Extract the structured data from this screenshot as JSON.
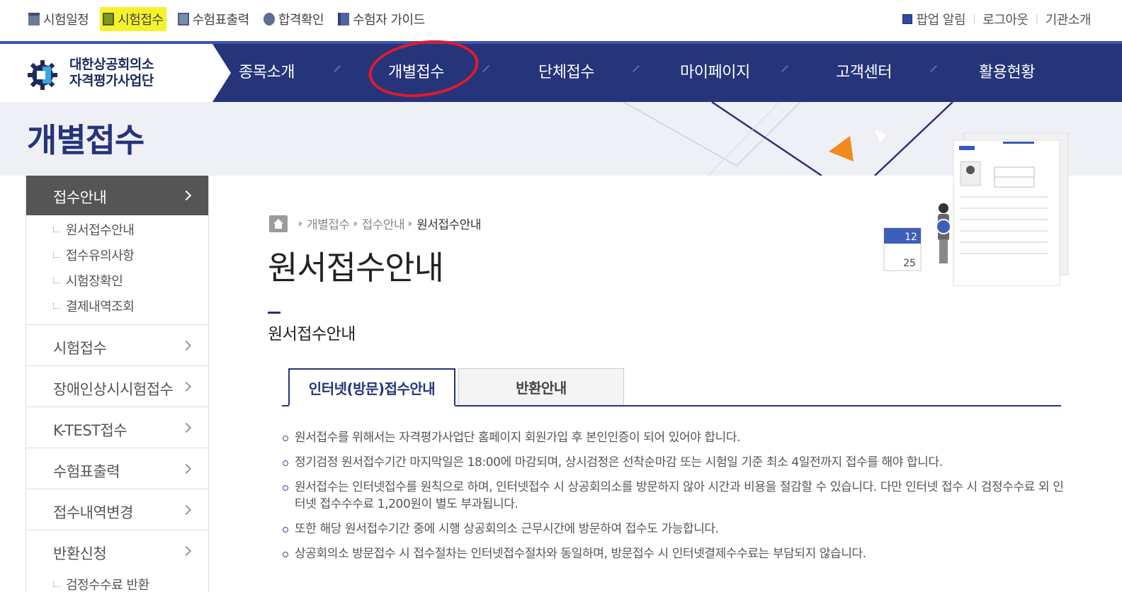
{
  "utility_nav": {
    "left": [
      {
        "label": "시험일정",
        "icon": "calendar-icon"
      },
      {
        "label": "시험접수",
        "icon": "pen-icon",
        "active": true
      },
      {
        "label": "수험표출력",
        "icon": "print-icon"
      },
      {
        "label": "합격확인",
        "icon": "badge-icon"
      },
      {
        "label": "수험자 가이드",
        "icon": "book-icon"
      }
    ],
    "right": [
      {
        "label": "팝업 알림",
        "icon": "popup-icon"
      },
      {
        "label": "로그아웃"
      },
      {
        "label": "기관소개"
      }
    ]
  },
  "logo": {
    "line1": "대한상공회의소",
    "line2": "자격평가사업단"
  },
  "main_nav": [
    {
      "label": "종목소개"
    },
    {
      "label": "개별접수",
      "highlighted": true
    },
    {
      "label": "단체접수"
    },
    {
      "label": "마이페이지"
    },
    {
      "label": "고객센터"
    },
    {
      "label": "활용현황"
    }
  ],
  "hero": {
    "title": "개별접수"
  },
  "sidebar": {
    "header": "접수안내",
    "sub_items": [
      {
        "label": "원서접수안내"
      },
      {
        "label": "접수유의사항"
      },
      {
        "label": "시험장확인"
      },
      {
        "label": "결제내역조회"
      }
    ],
    "items": [
      {
        "label": "시험접수"
      },
      {
        "label": "장애인상시시험접수"
      },
      {
        "label": "K-TEST접수"
      },
      {
        "label": "수험표출력"
      },
      {
        "label": "접수내역변경"
      },
      {
        "label": "반환신청"
      }
    ],
    "trailing_sub": "검정수수료 반환"
  },
  "breadcrumb": {
    "items": [
      "개별접수",
      "접수안내"
    ],
    "current": "원서접수안내"
  },
  "page": {
    "title": "원서접수안내",
    "section_title": "원서접수안내"
  },
  "tabs": [
    {
      "label": "인터넷(방문)접수안내",
      "active": true
    },
    {
      "label": "반환안내",
      "active": false
    }
  ],
  "info_items": [
    "원서접수를 위해서는 자격평가사업단 홈페이지 회원가입 후 본인인증이 되어 있어야 합니다.",
    "정기검정 원서접수기간 마지막일은 18:00에 마감되며, 상시검정은 선착순마감 또는 시험일 기준 최소 4일전까지 접수를 해야 합니다.",
    "원서접수는 인터넷접수를 원칙으로 하며, 인터넷접수 시 상공회의소를 방문하지 않아 시간과 비용을 절감할 수 있습니다. 다만 인터넷 접수 시 검정수수료 외 인터넷 접수수수료 1,200원이 별도 부과됩니다.",
    "또한 해당 원서접수기간 중에 시행 상공회의소 근무시간에 방문하여 접수도 가능합니다.",
    "상공회의소 방문접수 시 접수절차는 인터넷접수절차와 동일하며, 방문접수 시 인터넷결제수수료는 부담되지 않습니다."
  ],
  "illustration": {
    "calendar_top": "12",
    "calendar_bottom": "25"
  },
  "colors": {
    "nav_bg": "#26347a",
    "highlight_yellow": "#f7f12c",
    "annotation_red": "#e01b2b"
  }
}
